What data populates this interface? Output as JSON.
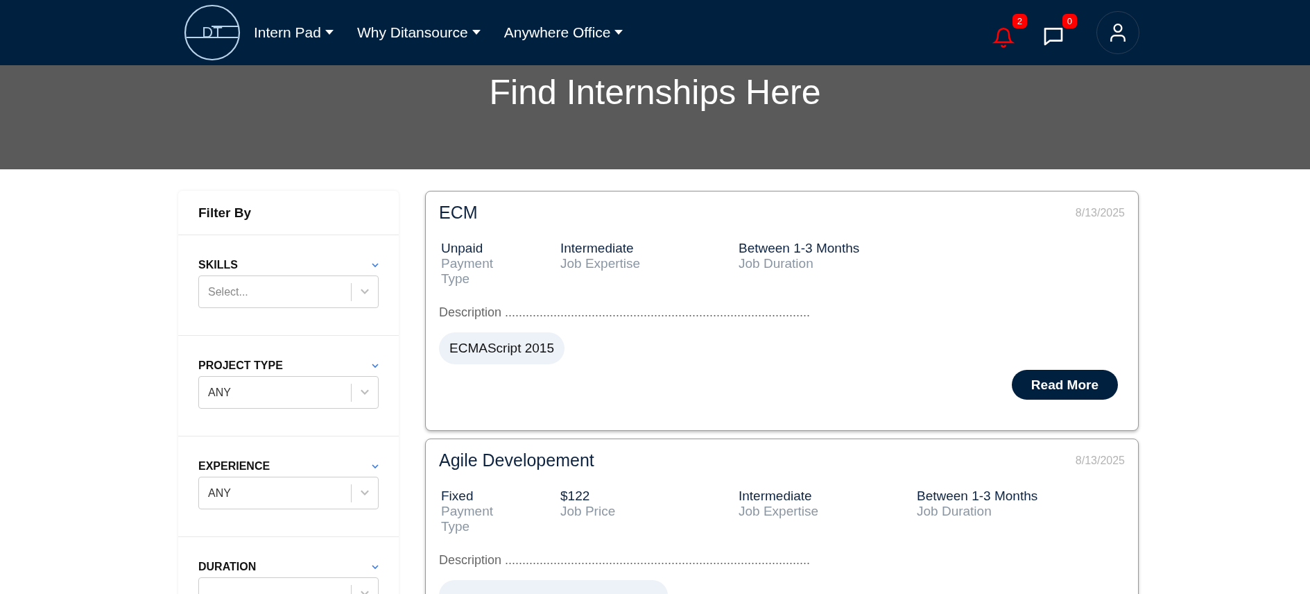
{
  "header": {
    "logo": "DT",
    "nav": [
      {
        "label": "Intern Pad"
      },
      {
        "label": "Why Ditansource"
      },
      {
        "label": "Anywhere Office"
      }
    ],
    "notifications": {
      "count": "2",
      "alert": true
    },
    "messages": {
      "count": "0",
      "alert": false
    }
  },
  "hero": {
    "title": "Find Internships Here"
  },
  "filters": {
    "title": "Filter By",
    "sections": [
      {
        "label": "SKILLS",
        "placeholder": "Select..."
      },
      {
        "label": "PROJECT TYPE",
        "value": "ANY"
      },
      {
        "label": "EXPERIENCE",
        "value": "ANY"
      },
      {
        "label": "DURATION"
      }
    ]
  },
  "jobs": [
    {
      "title": "ECM",
      "date": "8/13/2025",
      "stats": [
        {
          "value": "Unpaid",
          "label": "Payment Type"
        },
        {
          "value": "Intermediate",
          "label": "Job Expertise"
        },
        {
          "value": "Between 1-3 Months",
          "label": "Job Duration"
        }
      ],
      "description": "Description ........................................................................................",
      "tags": [
        "ECMAScript 2015"
      ],
      "button": "Read More"
    },
    {
      "title": "Agile Developement",
      "date": "8/13/2025",
      "stats": [
        {
          "value": "Fixed",
          "label": "Payment Type"
        },
        {
          "value": "$122",
          "label": "Job Price"
        },
        {
          "value": "Intermediate",
          "label": "Job Expertise"
        },
        {
          "value": "Between 1-3 Months",
          "label": "Job Duration"
        }
      ],
      "description": "Description ........................................................................................",
      "tag_cut_off": true
    }
  ]
}
